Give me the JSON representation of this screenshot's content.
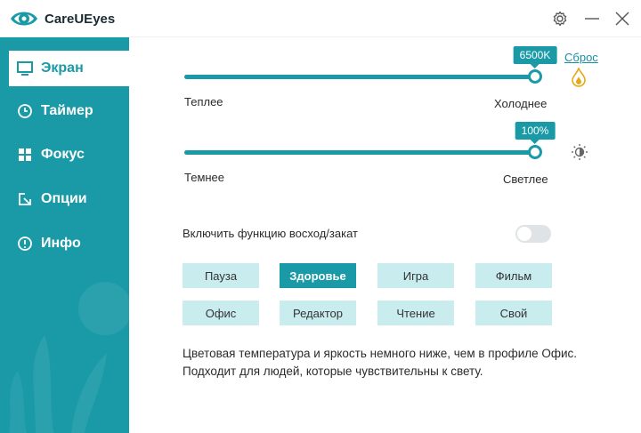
{
  "app": {
    "title": "CareUEyes"
  },
  "colors": {
    "accent": "#1a9aa7",
    "light_accent": "#c9ecef"
  },
  "sidebar": {
    "items": [
      {
        "label": "Экран",
        "icon": "monitor-icon",
        "active": true
      },
      {
        "label": "Таймер",
        "icon": "clock-icon",
        "active": false
      },
      {
        "label": "Фокус",
        "icon": "windows-icon",
        "active": false
      },
      {
        "label": "Опции",
        "icon": "options-icon",
        "active": false
      },
      {
        "label": "Инфо",
        "icon": "info-icon",
        "active": false
      }
    ]
  },
  "temperature": {
    "value_label": "6500K",
    "level": 1.0,
    "min_label": "Теплее",
    "max_label": "Холоднее",
    "reset_label": "Сброс",
    "icon": "flame-icon"
  },
  "brightness": {
    "value_label": "100%",
    "level": 1.0,
    "min_label": "Темнее",
    "max_label": "Светлее",
    "icon": "brightness-icon"
  },
  "sunrise": {
    "label": "Включить функцию восход/закат",
    "enabled": false
  },
  "presets": [
    {
      "label": "Пауза",
      "active": false
    },
    {
      "label": "Здоровье",
      "active": true
    },
    {
      "label": "Игра",
      "active": false
    },
    {
      "label": "Фильм",
      "active": false
    },
    {
      "label": "Офис",
      "active": false
    },
    {
      "label": "Редактор",
      "active": false
    },
    {
      "label": "Чтение",
      "active": false
    },
    {
      "label": "Свой",
      "active": false
    }
  ],
  "description": {
    "line1": "Цветовая температура и яркость немного ниже, чем в профиле Офис.",
    "line2": "Подходит для людей, которые чувствительны к свету."
  },
  "titlebar_icons": [
    "settings-icon",
    "minimize-icon",
    "close-icon"
  ]
}
